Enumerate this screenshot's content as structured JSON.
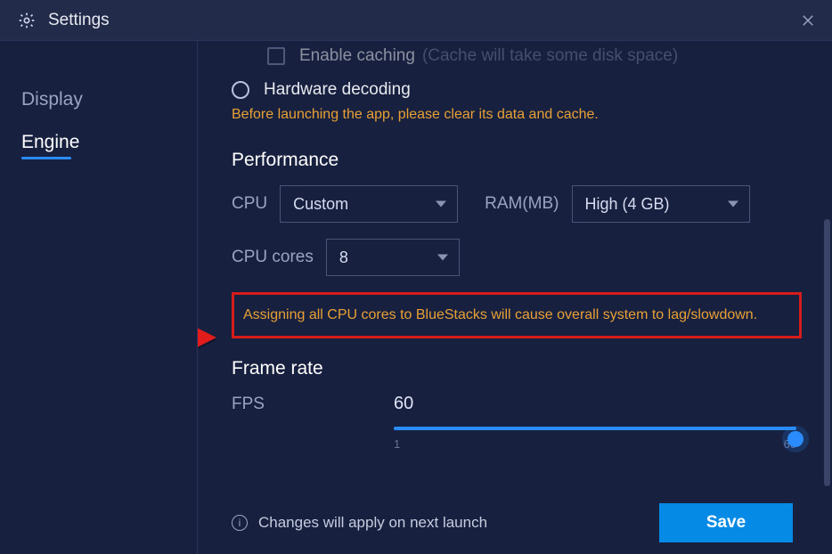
{
  "window": {
    "title": "Settings"
  },
  "sidebar": {
    "items": [
      {
        "label": "Display",
        "active": false
      },
      {
        "label": "Engine",
        "active": true
      }
    ]
  },
  "caching": {
    "label": "Enable caching",
    "hint": "(Cache will take some disk space)",
    "checked": false
  },
  "hw_decode": {
    "label": "Hardware decoding",
    "selected": false,
    "note": "Before launching the app, please clear its data and cache."
  },
  "performance": {
    "title": "Performance",
    "cpu_label": "CPU",
    "cpu_value": "Custom",
    "ram_label": "RAM(MB)",
    "ram_value": "High (4 GB)",
    "cores_label": "CPU cores",
    "cores_value": "8",
    "cores_warning": "Assigning all CPU cores to BlueStacks will cause overall system to lag/slowdown."
  },
  "frame_rate": {
    "title": "Frame rate",
    "fps_label": "FPS",
    "fps_value": "60",
    "slider_min": "1",
    "slider_max": "60"
  },
  "footer": {
    "info_text": "Changes will apply on next launch",
    "save_label": "Save"
  }
}
